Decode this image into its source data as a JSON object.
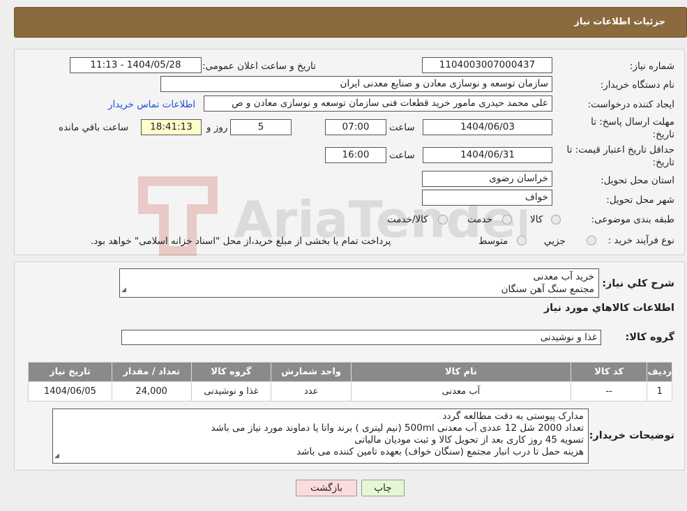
{
  "header": {
    "title": "جزئیات اطلاعات نیاز"
  },
  "labels": {
    "need_number": "شماره نیاز:",
    "announce_datetime": "تاریخ و ساعت اعلان عمومی:",
    "buyer_org": "نام دستگاه خریدار:",
    "requester": "ایجاد کننده درخواست:",
    "deadline": "مهلت ارسال پاسخ: تا تاریخ:",
    "time": "ساعت",
    "day_and": "روز و",
    "remaining": "ساعت باقي مانده",
    "min_validity": "حداقل تاریخ اعتبار قیمت: تا تاریخ:",
    "province": "استان محل تحویل:",
    "city": "شهر محل تحویل:",
    "category": "طبقه بندی موضوعی:",
    "purchase_type": "نوع فرآیند خرید :",
    "description": "شرح کلي نياز:",
    "goods_info": "اطلاعات کالاهاي مورد نياز",
    "goods_group": "گروه کالا:",
    "buyer_notes": "توضیحات خریدار:"
  },
  "values": {
    "need_number": "1104003007000437",
    "announce_datetime": "1404/05/28 - 11:13",
    "buyer_org": "سازمان توسعه و نوسازی معادن و صنایع معدنی ایران",
    "requester": "علی محمد حیدری مامور خرید قطعات فنی سازمان توسعه و نوسازی معادن و ص",
    "contact_link": "اطلاعات تماس خریدار",
    "deadline_date": "1404/06/03",
    "deadline_time": "07:00",
    "days": "5",
    "remaining_time": "18:41:13",
    "validity_date": "1404/06/31",
    "validity_time": "16:00",
    "province": "خراسان رضوی",
    "city": "خواف"
  },
  "category_options": [
    {
      "label": "کالا",
      "selected": false
    },
    {
      "label": "خدمت",
      "selected": false
    },
    {
      "label": "کالا/خدمت",
      "selected": false
    }
  ],
  "purchase_options": [
    {
      "label": "جزیي",
      "selected": false
    },
    {
      "label": "متوسط",
      "selected": false
    }
  ],
  "purchase_note": "پرداخت تمام یا بخشی از مبلغ خرید،از محل \"اسناد خزانه اسلامی\" خواهد بود.",
  "description_lines": [
    "خرید آب معدنی",
    "مجتمع سنگ آهن سنگان"
  ],
  "goods_group": "غذا و نوشیدنی",
  "table": {
    "headers": [
      "ردیف",
      "کد کالا",
      "نام کالا",
      "واحد شمارش",
      "گروه کالا",
      "تعداد / مقدار",
      "تاریخ نیاز"
    ],
    "rows": [
      [
        "1",
        "--",
        "آب معدنی",
        "عدد",
        "غذا و نوشیدنی",
        "24,000",
        "1404/06/05"
      ]
    ]
  },
  "notes_lines": [
    "مدارک پیوستی به دقت مطالعه گردد",
    "تعداد 2000 شل 12 عددی آب معدنی 500ml (نیم لیتری ) برند واتا یا دماوند مورد نیاز می باشد",
    "تسویه 45 روز کاری بعد از تحویل کالا و ثبت مودیان مالیاتی",
    "هزینه حمل تا درب انبار مجتمع (سنگان خواف) بعهده تامین کننده می باشد"
  ],
  "buttons": {
    "print": "چاپ",
    "back": "بازگشت"
  },
  "watermark": "AriaTender.neT",
  "colors": {
    "header": "#8b6a3e",
    "link": "#1a4fd6",
    "print_btn": "#e6f7d4",
    "back_btn": "#fbdcdc"
  }
}
